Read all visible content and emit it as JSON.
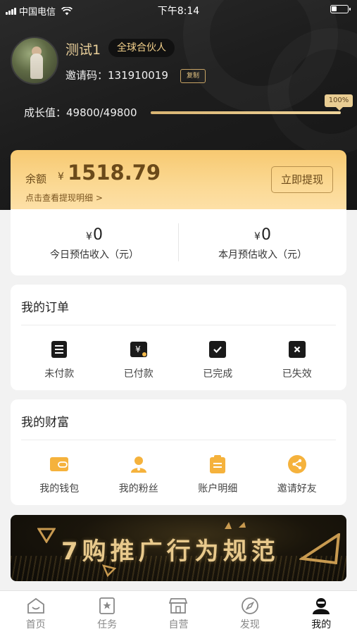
{
  "status_bar": {
    "carrier": "中国电信",
    "time": "下午8:14"
  },
  "profile": {
    "nickname": "测试1",
    "badge": "全球合伙人",
    "invite_label": "邀请码：131910019",
    "copy_label": "复制",
    "growth_label": "成长值：49800/49800",
    "growth_pct_label": "100%",
    "growth_progress": 1.0
  },
  "balance": {
    "label": "余额",
    "currency": "¥",
    "amount": "1518.79",
    "detail_link": "点击查看提现明细 >",
    "withdraw_label": "立即提现"
  },
  "income": [
    {
      "currency": "¥",
      "value": "0",
      "label": "今日预估收入（元）"
    },
    {
      "currency": "¥",
      "value": "0",
      "label": "本月预估收入（元）"
    }
  ],
  "orders": {
    "title": "我的订单",
    "items": [
      {
        "label": "未付款",
        "icon": "clipboard-list-icon"
      },
      {
        "label": "已付款",
        "icon": "yen-paid-icon"
      },
      {
        "label": "已完成",
        "icon": "check-box-icon"
      },
      {
        "label": "已失效",
        "icon": "x-box-icon"
      }
    ]
  },
  "wealth": {
    "title": "我的财富",
    "items": [
      {
        "label": "我的钱包",
        "icon": "wallet-icon"
      },
      {
        "label": "我的粉丝",
        "icon": "user-icon"
      },
      {
        "label": "账户明细",
        "icon": "clipboard-icon"
      },
      {
        "label": "邀请好友",
        "icon": "share-icon"
      }
    ]
  },
  "banner": {
    "text": "7购推广行为规范"
  },
  "tabbar": [
    {
      "label": "首页",
      "icon": "home-icon",
      "active": false
    },
    {
      "label": "任务",
      "icon": "task-star-icon",
      "active": false
    },
    {
      "label": "自营",
      "icon": "store-icon",
      "active": false
    },
    {
      "label": "发现",
      "icon": "compass-icon",
      "active": false
    },
    {
      "label": "我的",
      "icon": "profile-icon",
      "active": true
    }
  ],
  "colors": {
    "gold": "#e9cf9a",
    "balance_bg": "#fbd994",
    "accent_orange": "#f5b23c",
    "dark": "#1d1d1d"
  }
}
